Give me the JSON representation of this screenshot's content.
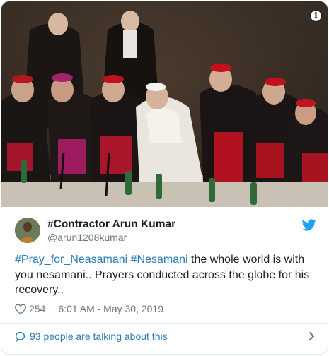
{
  "media": {
    "alt_icon": "info-icon",
    "info_label": "i"
  },
  "author": {
    "name": "#Contractor Arun Kumar",
    "handle": "@arun1208kumar",
    "platform_icon": "twitter-bird-icon",
    "brand_color": "#1da1f2"
  },
  "tweet": {
    "hashtag_1": "#Pray_for_Neasamani",
    "hashtag_2": "#Nesamani",
    "body": " the whole world is with you nesamani.. Prayers conducted across the globe for his recovery..",
    "link_color": "#2b7bb9"
  },
  "meta": {
    "like_icon": "heart-icon",
    "likes": "254",
    "timestamp": "6:01 AM - May 30, 2019"
  },
  "footer": {
    "icon": "speech-bubble-icon",
    "label": "93 people are talking about this",
    "chevron": "chevron-right-icon"
  }
}
